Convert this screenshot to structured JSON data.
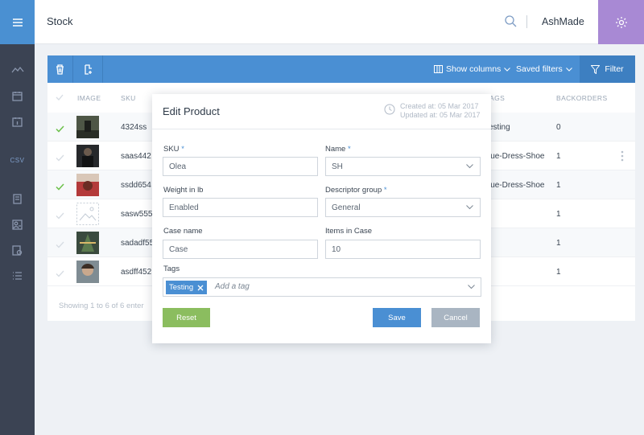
{
  "header": {
    "title": "Stock",
    "user": "AshMade"
  },
  "sidebar": {
    "csv_label": "CSV"
  },
  "toolbar": {
    "show_columns": "Show columns",
    "saved_filters": "Saved filters",
    "filter": "Filter"
  },
  "table": {
    "columns": {
      "image": "IMAGE",
      "sku": "SKU",
      "tags": "AGS",
      "backorders": "BACKORDERS"
    },
    "rows": [
      {
        "sku": "4324ss",
        "tags": "esting",
        "backorders": "0",
        "checked": true
      },
      {
        "sku": "saas442",
        "tags": "lue-Dress-Shoe",
        "backorders": "1",
        "checked": false
      },
      {
        "sku": "ssdd654",
        "tags": "lue-Dress-Shoe",
        "backorders": "1",
        "checked": true
      },
      {
        "sku": "sasw555",
        "tags": "",
        "backorders": "1",
        "checked": false
      },
      {
        "sku": "sadadf55",
        "tags": "",
        "backorders": "1",
        "checked": false
      },
      {
        "sku": "asdff452",
        "tags": "",
        "backorders": "1",
        "checked": false
      }
    ],
    "showing": "Showing 1 to 6 of 6 enter"
  },
  "modal": {
    "title": "Edit Product",
    "created": "Created at:  05 Mar 2017",
    "updated": "Updated at:  05 Mar 2017",
    "sku_label": "SKU",
    "sku_value": "Olea",
    "name_label": "Name",
    "name_value": "SH",
    "weight_label": "Weight in lb",
    "weight_value": "Enabled",
    "descriptor_label": "Descriptor group",
    "descriptor_value": "General",
    "case_label": "Case name",
    "case_value": "Case",
    "items_label": "Items in Case",
    "items_value": "10",
    "tags_label": "Tags",
    "tag_chip": "Testing",
    "tag_placeholder": "Add a tag",
    "reset": "Reset",
    "save": "Save",
    "cancel": "Cancel"
  },
  "colors": {
    "primary": "#4a8fd3",
    "settings_bg": "#a889d4",
    "reset": "#8bbd5f",
    "cancel": "#a9b5c2",
    "sidebar": "#3b4353"
  }
}
